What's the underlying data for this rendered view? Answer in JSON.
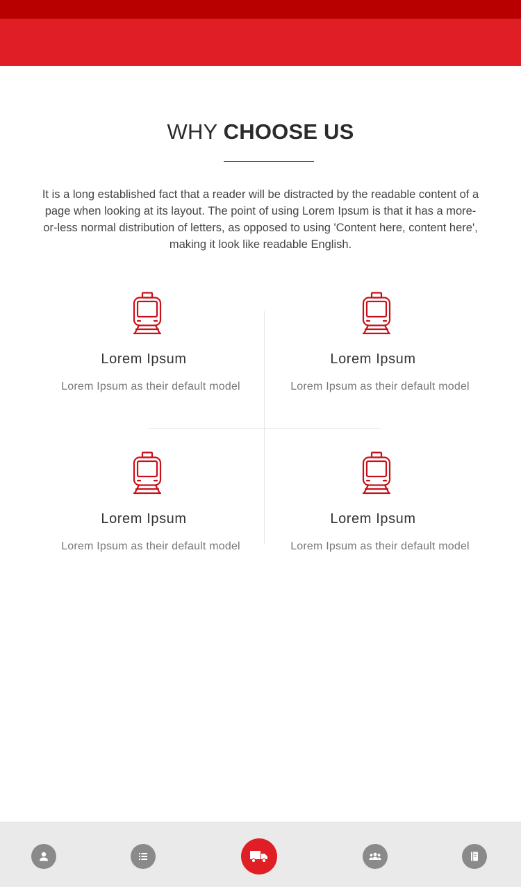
{
  "section": {
    "title_light": "WHY ",
    "title_bold": "CHOOSE US",
    "intro": "It is a long established fact that a reader will be distracted by the readable content of a page when looking at its layout. The point of using Lorem Ipsum is that it has a more-or-less normal distribution of letters, as opposed to using 'Content here, content here', making it look like readable English."
  },
  "features": [
    {
      "icon": "train-icon",
      "title": "Lorem Ipsum",
      "description": "Lorem Ipsum as their default model"
    },
    {
      "icon": "train-icon",
      "title": "Lorem Ipsum",
      "description": "Lorem Ipsum as their default model"
    },
    {
      "icon": "train-icon",
      "title": "Lorem Ipsum",
      "description": "Lorem Ipsum as their default model"
    },
    {
      "icon": "train-icon",
      "title": "Lorem Ipsum",
      "description": "Lorem Ipsum as their default model"
    }
  ],
  "bottom_nav": {
    "items": [
      {
        "icon": "person-icon",
        "active": false
      },
      {
        "icon": "list-icon",
        "active": false
      },
      {
        "icon": "truck-icon",
        "active": true
      },
      {
        "icon": "group-icon",
        "active": false
      },
      {
        "icon": "book-icon",
        "active": false
      }
    ]
  },
  "colors": {
    "status_bar": "#b90000",
    "app_bar": "#e01e26",
    "accent": "#e01e26",
    "nav_inactive": "#8a8a8a",
    "nav_background": "#eaeaea"
  }
}
